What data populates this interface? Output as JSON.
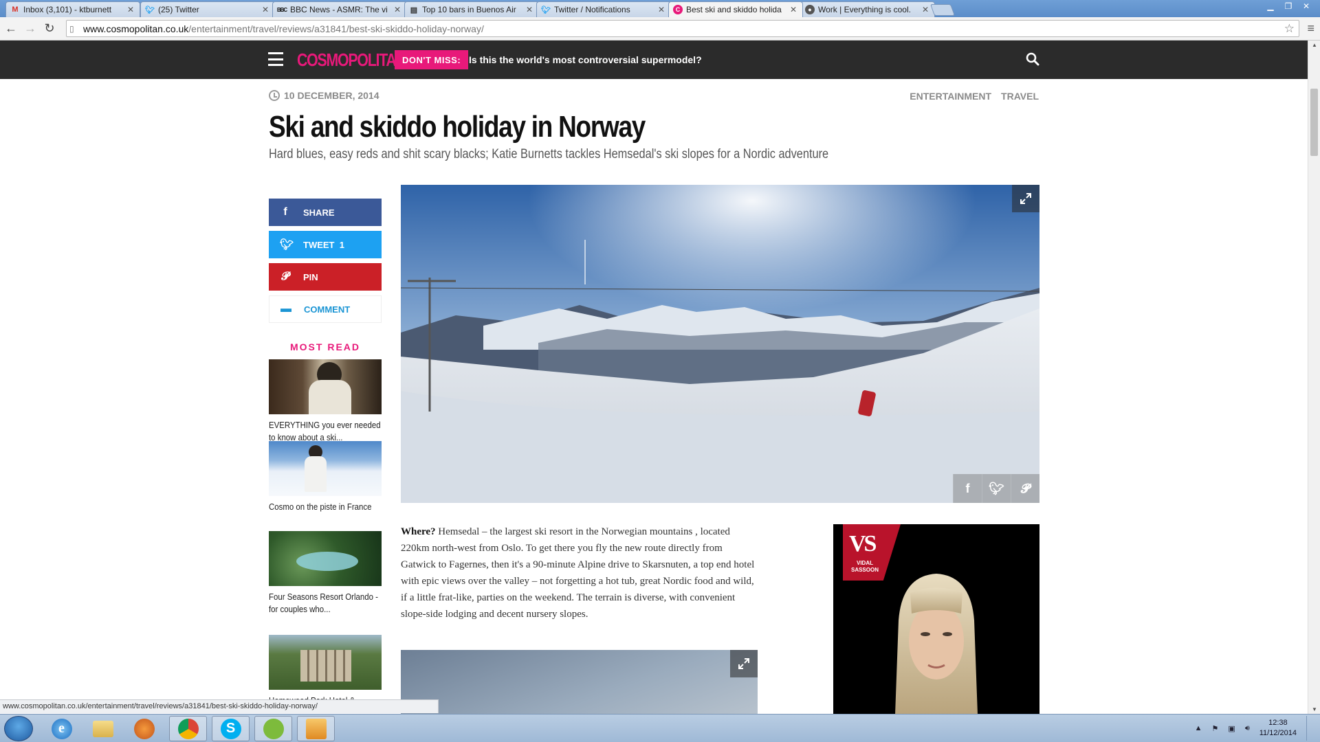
{
  "browser": {
    "tabs": [
      {
        "title": "Inbox (3,101) - ktburnett",
        "icon": "gmail-icon",
        "active": false
      },
      {
        "title": "(25) Twitter",
        "icon": "twitter-icon",
        "active": false
      },
      {
        "title": "BBC News - ASMR: The vi",
        "icon": "bbc-icon",
        "active": false
      },
      {
        "title": "Top 10 bars in Buenos Air",
        "icon": "page-icon",
        "active": false
      },
      {
        "title": "Twitter / Notifications",
        "icon": "twitter-icon",
        "active": false
      },
      {
        "title": "Best ski and skiddo holida",
        "icon": "cosmo-icon",
        "active": true
      },
      {
        "title": "Work | Everything is cool.",
        "icon": "avatar-icon",
        "active": false
      }
    ],
    "url_host": "www.cosmopolitan.co.uk",
    "url_path": "/entertainment/travel/reviews/a31841/best-ski-skiddo-holiday-norway/"
  },
  "site": {
    "logo": "COSMOPOLITAN",
    "dont_miss": "DON'T MISS:",
    "teaser": "Is this the world's most controversial supermodel?",
    "brand_color": "#e8197a"
  },
  "article": {
    "date": "10 DECEMBER, 2014",
    "categories": [
      "ENTERTAINMENT",
      "TRAVEL"
    ],
    "title": "Ski and skiddo holiday in Norway",
    "standfirst": "Hard blues, easy reds and shit scary blacks; Katie Burnetts tackles Hemsedal's ski slopes for a Nordic adventure",
    "body_lead": "Where?",
    "body": "Hemsedal – the largest ski resort in the Norwegian mountains , located 220km north-west from Oslo. To get there you fly the new route directly from Gatwick to Fagernes, then it's a 90-minute Alpine drive to Skarsnuten, a top end hotel with epic views over the valley – not forgetting a hot tub, great Nordic food and wild, if a little frat-like, parties on the weekend. The terrain is diverse, with convenient slope-side lodging and decent nursery slopes."
  },
  "share": {
    "share_label": "SHARE",
    "tweet_label": "TWEET",
    "tweet_count": "1",
    "pin_label": "PIN",
    "comment_label": "COMMENT"
  },
  "most_read": {
    "heading": "MOST READ",
    "items": [
      {
        "caption": "EVERYTHING you ever needed to know about a ski..."
      },
      {
        "caption": "Cosmo on the piste in France"
      },
      {
        "caption": "Four Seasons Resort Orlando - for couples who..."
      },
      {
        "caption": "Homewood Park Hotel &..."
      }
    ]
  },
  "ad": {
    "brand_top": "VS",
    "brand_name": "VIDAL SASSOON"
  },
  "status_url": "www.cosmopolitan.co.uk/entertainment/travel/reviews/a31841/best-ski-skiddo-holiday-norway/",
  "taskbar": {
    "time": "12:38",
    "date": "11/12/2014"
  }
}
